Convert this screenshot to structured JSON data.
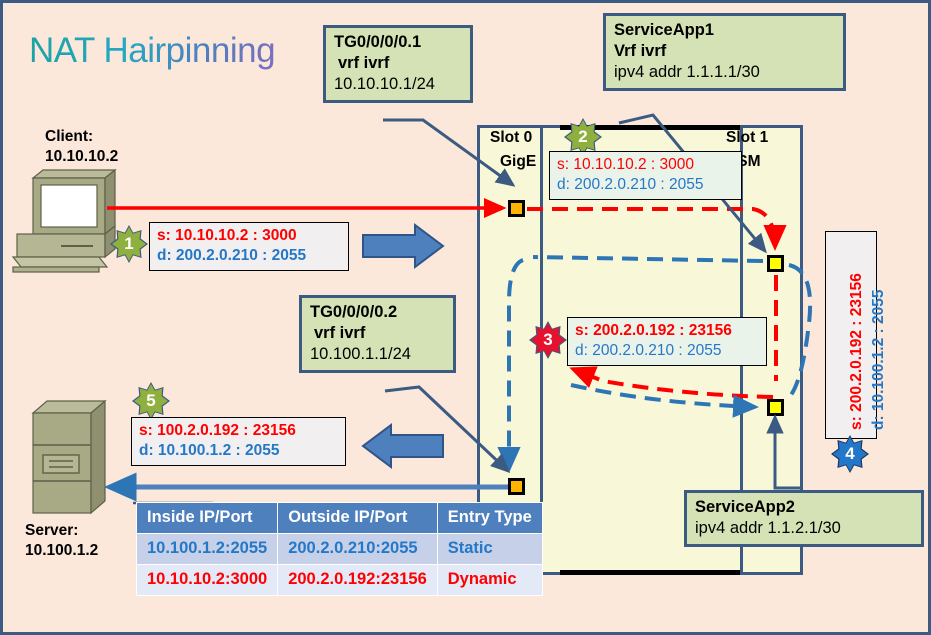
{
  "title": "NAT Hairpinning",
  "colors": {
    "background": "#fce8da",
    "border": "#3c5b82",
    "router_fill": "#f8f8d8",
    "green_box": "#d5e2b5",
    "src_red": "#ff0000",
    "dst_blue": "#2478c8",
    "table_header": "#4e80bd",
    "badge_green": "#8fb03e",
    "badge_red": "#e8112d",
    "badge_blue": "#2277c8",
    "port_orange": "#ffb300",
    "port_yellow": "#ffff00"
  },
  "nodes": {
    "client": {
      "line1": "Client:",
      "line2": "10.10.10.2"
    },
    "server": {
      "line1": "Server:",
      "line2": "10.100.1.2"
    }
  },
  "router": {
    "slot0_label": "Slot  0",
    "slot0_card": "GigE",
    "slot1_label": "Slot 1",
    "slot1_card": "ISM"
  },
  "interfaces": [
    {
      "name": "tg0-0-0-0-1",
      "line1": "TG0/0/0/0.1",
      "line2": "vrf ivrf",
      "line3": "10.10.10.1/24"
    },
    {
      "name": "tg0-0-0-0-2",
      "line1": "TG0/0/0/0.2",
      "line2": "vrf ivrf",
      "line3": "10.100.1.1/24"
    },
    {
      "name": "serviceapp1",
      "line1": "ServiceApp1",
      "line2": "Vrf ivrf",
      "line3": "ipv4 addr 1.1.1.1/30"
    },
    {
      "name": "serviceapp2",
      "line1": "ServiceApp2",
      "line2": "ipv4 addr 1.1.2.1/30",
      "line3": ""
    }
  ],
  "steps": [
    {
      "badge": "1",
      "badge_color": "green",
      "src": "s: 10.10.10.2 : 3000",
      "dst": "d: 200.2.0.210 : 2055"
    },
    {
      "badge": "2",
      "badge_color": "green",
      "src": "s: 10.10.10.2 : 3000",
      "dst": "d: 200.2.0.210 : 2055"
    },
    {
      "badge": "3",
      "badge_color": "red",
      "src": "s: 200.2.0.192 : 23156",
      "dst": "d: 200.2.0.210 : 2055"
    },
    {
      "badge": "4",
      "badge_color": "blue",
      "src": "s: 200.2.0.192 : 23156",
      "dst": "d: 10.100.1.2 : 2055"
    },
    {
      "badge": "5",
      "badge_color": "green",
      "src": "s: 100.2.0.192 : 23156",
      "dst": "d: 10.100.1.2 : 2055"
    }
  ],
  "nat_table": {
    "headers": [
      "Inside IP/Port",
      "Outside IP/Port",
      "Entry Type"
    ],
    "rows": [
      {
        "inside": "10.100.1.2:2055",
        "outside": "200.2.0.210:2055",
        "type": "Static"
      },
      {
        "inside": "10.10.10.2:3000",
        "outside": "200.2.0.192:23156",
        "type": "Dynamic"
      }
    ]
  }
}
